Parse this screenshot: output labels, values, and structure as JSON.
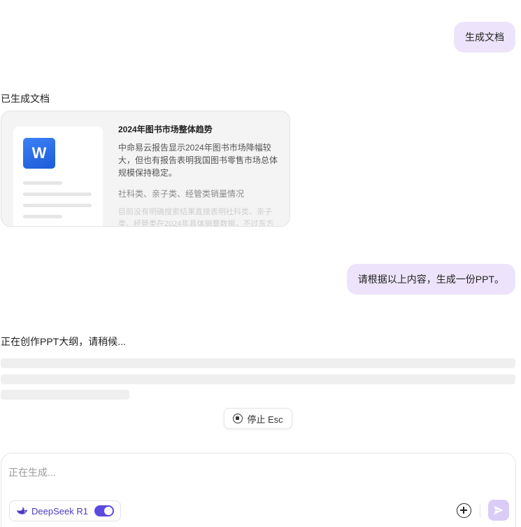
{
  "messages": {
    "user_request_1": "生成文档",
    "assistant_doc_status": "已生成文档",
    "user_request_2": "请根据以上内容，生成一份PPT。",
    "assistant_creating_status": "正在创作PPT大纲，请稍候..."
  },
  "doc_card": {
    "icon": "word-icon",
    "icon_letter": "W",
    "title": "2024年图书市场整体趋势",
    "paragraph": "中命易云报告显示2024年图书市场降幅较大，但也有报告表明我国图书零售市场总体规模保持稳定。",
    "subheading": "社科类、亲子类、经管类销量情况",
    "faded_text": "目前没有明确搜索结果直接表明社科类、亲子类、经管类在2024年具体销量数据，不过东方"
  },
  "stop_button": {
    "icon": "stop-circle-icon",
    "label": "停止 Esc"
  },
  "composer": {
    "placeholder": "正在生成...",
    "model_icon": "deepseek-whale-icon",
    "model_label": "DeepSeek R1",
    "model_enabled": true,
    "attach_icon": "plus-circle-icon",
    "send_icon": "send-icon"
  },
  "colors": {
    "user_bubble": "#ede4fb",
    "accent": "#5b4ae0",
    "send_button": "#d9cdf7",
    "word_blue": "#1d5bd8"
  }
}
